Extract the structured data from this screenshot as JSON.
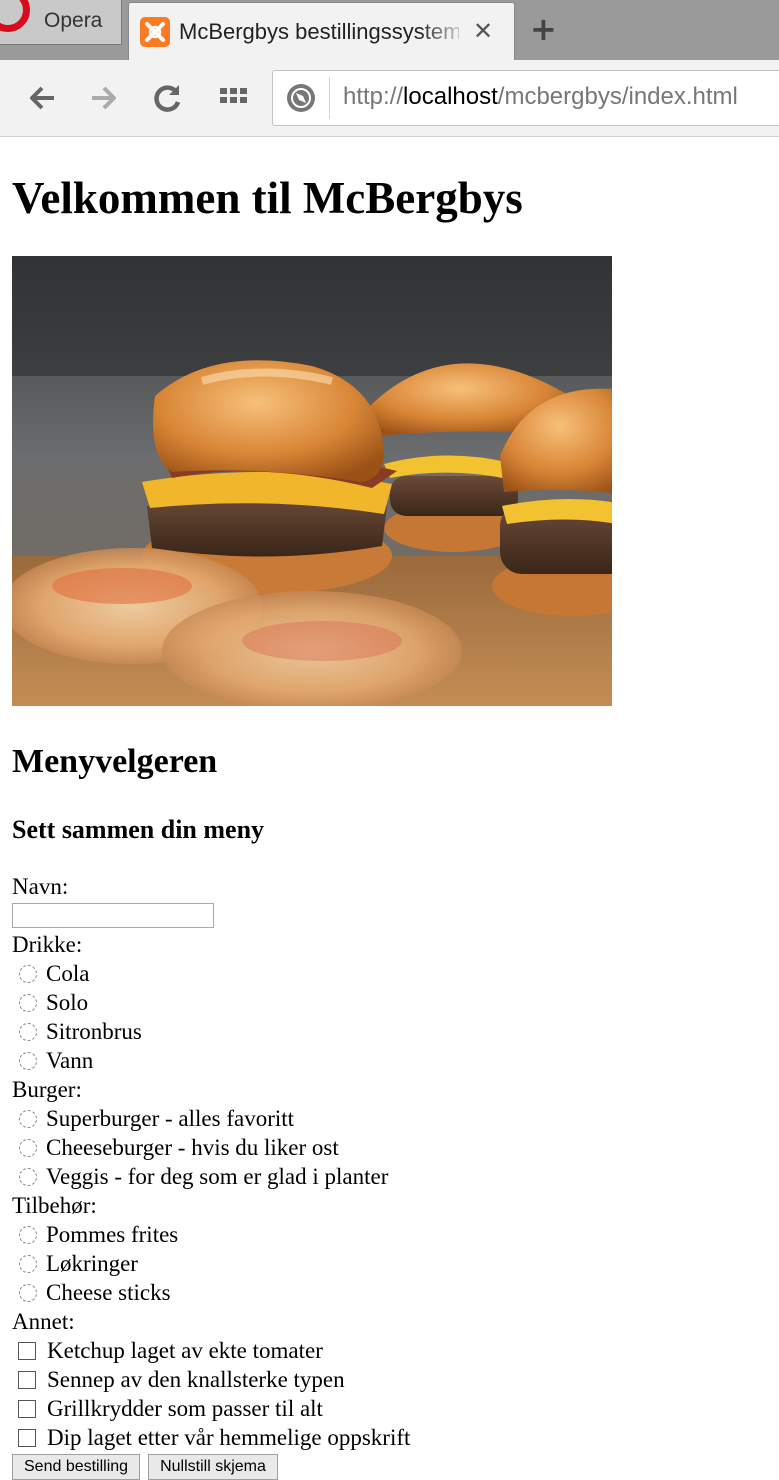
{
  "browser": {
    "inactive_tab": {
      "label": "Opera"
    },
    "active_tab": {
      "title": "McBergbys bestillingssystem",
      "close": "✕"
    },
    "new_tab": "+",
    "address": {
      "scheme": "http://",
      "host": "localhost",
      "path": "/mcbergbys/index.html"
    }
  },
  "page": {
    "heading": "Velkommen til McBergbys",
    "image": "burgers-photo",
    "section_title": "Menyvelgeren",
    "subtitle": "Sett sammen din meny",
    "form": {
      "name_label": "Navn:",
      "name_value": "",
      "drinks_label": "Drikke:",
      "drinks": [
        "Cola",
        "Solo",
        "Sitronbrus",
        "Vann"
      ],
      "burger_label": "Burger:",
      "burgers": [
        "Superburger - alles favoritt",
        "Cheeseburger - hvis du liker ost",
        "Veggis - for deg som er glad i planter"
      ],
      "sides_label": "Tilbehør:",
      "sides": [
        "Pommes frites",
        "Løkringer",
        "Cheese sticks"
      ],
      "extras_label": "Annet:",
      "extras": [
        "Ketchup laget av ekte tomater",
        "Sennep av den knallsterke typen",
        "Grillkrydder som passer til alt",
        "Dip laget etter vår hemmelige oppskrift"
      ],
      "submit_label": "Send bestilling",
      "reset_label": "Nullstill skjema"
    }
  }
}
